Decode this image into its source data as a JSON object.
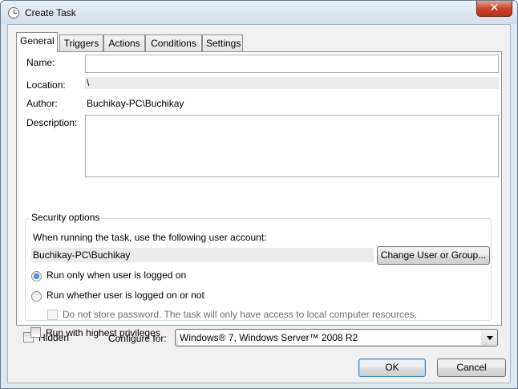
{
  "window": {
    "title": "Create Task",
    "close_glyph": "✕"
  },
  "tabs": [
    {
      "label": "General",
      "active": true
    },
    {
      "label": "Triggers",
      "active": false
    },
    {
      "label": "Actions",
      "active": false
    },
    {
      "label": "Conditions",
      "active": false
    },
    {
      "label": "Settings",
      "active": false
    }
  ],
  "general": {
    "name_label": "Name:",
    "name_value": "",
    "location_label": "Location:",
    "location_value": "\\",
    "author_label": "Author:",
    "author_value": "Buchikay-PC\\Buchikay",
    "description_label": "Description:",
    "description_value": ""
  },
  "security": {
    "title": "Security options",
    "account_prompt": "When running the task, use the following user account:",
    "account_value": "Buchikay-PC\\Buchikay",
    "change_user_button": "Change User or Group...",
    "radio_logged_on": "Run only when user is logged on",
    "radio_whether": "Run whether user is logged on or not",
    "no_store_password": "Do not store password.  The task will only have access to local computer resources.",
    "highest_privileges": "Run with highest privileges"
  },
  "bottom": {
    "hidden_label": "Hidden",
    "configure_label": "Configure for:",
    "configure_value": "Windows® 7, Windows Server™ 2008 R2"
  },
  "buttons": {
    "ok": "OK",
    "cancel": "Cancel"
  }
}
